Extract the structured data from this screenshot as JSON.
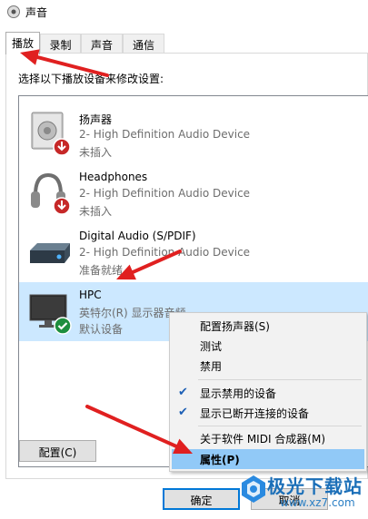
{
  "window": {
    "title": "声音"
  },
  "tabs": [
    {
      "label": "播放",
      "active": true
    },
    {
      "label": "录制",
      "active": false
    },
    {
      "label": "声音",
      "active": false
    },
    {
      "label": "通信",
      "active": false
    }
  ],
  "instruction": "选择以下播放设备来修改设置:",
  "devices": [
    {
      "name": "扬声器",
      "description": "2- High Definition Audio Device",
      "status": "未插入",
      "icon": "speaker-icon",
      "badge": "unplugged-badge"
    },
    {
      "name": "Headphones",
      "description": "2- High Definition Audio Device",
      "status": "未插入",
      "icon": "headphones-icon",
      "badge": "unplugged-badge"
    },
    {
      "name": "Digital Audio (S/PDIF)",
      "description": "2- High Definition Audio Device",
      "status": "准备就绪",
      "icon": "digital-audio-icon",
      "badge": ""
    },
    {
      "name": "HPC",
      "description": "英特尔(R) 显示器音频",
      "status": "默认设备",
      "icon": "monitor-icon",
      "badge": "default-check-badge",
      "selected": true
    }
  ],
  "buttons": {
    "configure": "配置(C)",
    "ok": "确定",
    "cancel": "取消"
  },
  "context_menu": {
    "items": [
      {
        "label": "配置扬声器(S)",
        "checked": false
      },
      {
        "label": "测试",
        "checked": false
      },
      {
        "label": "禁用",
        "checked": false
      },
      {
        "label": "显示禁用的设备",
        "checked": true
      },
      {
        "label": "显示已断开连接的设备",
        "checked": true
      },
      {
        "label": "关于软件 MIDI 合成器(M)",
        "checked": false
      },
      {
        "label": "属性(P)",
        "checked": false,
        "highlighted": true
      }
    ]
  },
  "annotations": {
    "arrow_color": "#e02020"
  },
  "watermark": {
    "brand": "极光下载站",
    "url": "www.xz7.com"
  }
}
